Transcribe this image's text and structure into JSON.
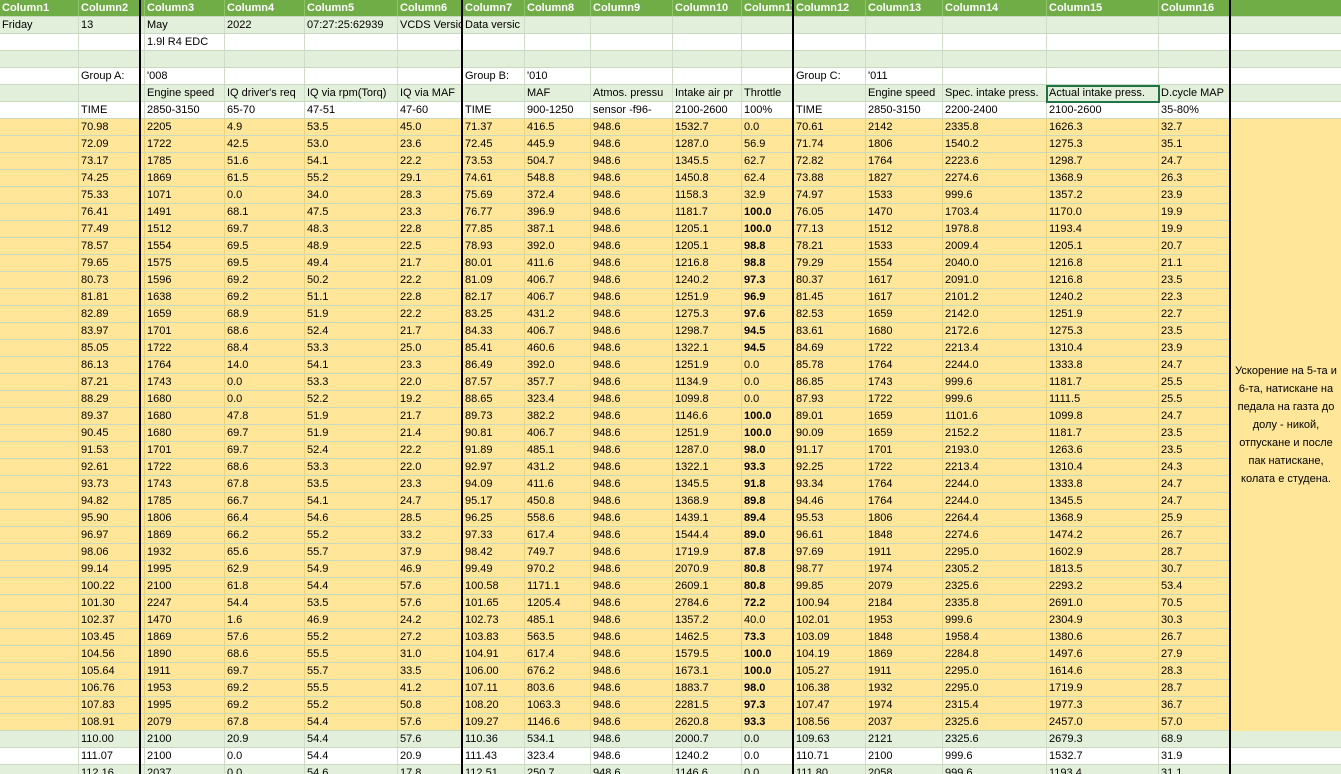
{
  "headers": [
    "Column1",
    "Column2",
    "Column3",
    "Column4",
    "Column5",
    "Column6",
    "Column7",
    "Column8",
    "Column9",
    "Column10",
    "Column11",
    "Column12",
    "Column13",
    "Column14",
    "Column15",
    "Column16"
  ],
  "top_rows": [
    {
      "style": "green",
      "cells": [
        "Friday",
        "13",
        "May",
        "2022",
        "07:27:25:62939",
        "VCDS Versio",
        "Data versic",
        "",
        "",
        "",
        "",
        "",
        "",
        "",
        "",
        ""
      ]
    },
    {
      "style": "white",
      "cells": [
        "",
        "",
        "1.9l R4 EDC",
        "",
        "",
        "",
        "",
        "",
        "",
        "",
        "",
        "",
        "",
        "",
        "",
        ""
      ]
    },
    {
      "style": "green",
      "cells": [
        "",
        "",
        "",
        "",
        "",
        "",
        "",
        "",
        "",
        "",
        "",
        "",
        "",
        "",
        "",
        ""
      ]
    },
    {
      "style": "white",
      "cells": [
        "",
        "Group A:",
        "'008",
        "",
        "",
        "",
        "Group B:",
        "'010",
        "",
        "",
        "",
        "Group C:",
        "'011",
        "",
        "",
        ""
      ]
    },
    {
      "style": "green",
      "cells": [
        "",
        "",
        "Engine speed",
        "IQ driver's req",
        "IQ via rpm(Torq)",
        "IQ via MAF",
        "",
        "MAF",
        "Atmos. pressu",
        "Intake air pr",
        "Throttle",
        "",
        "Engine speed",
        "Spec. intake press.",
        "Actual intake press.",
        "D.cycle MAP"
      ]
    },
    {
      "style": "white",
      "cells": [
        "",
        "TIME",
        "2850-3150",
        "65-70",
        "47-51",
        "47-60",
        "TIME",
        "900-1250",
        "sensor -f96-",
        "2100-2600",
        "100%",
        "TIME",
        "2850-3150",
        "2200-2400",
        "2100-2600",
        "35-80%"
      ]
    }
  ],
  "data_rows": [
    [
      "70.98",
      "2205",
      "4.9",
      "53.5",
      "45.0",
      "71.37",
      "416.5",
      "948.6",
      "1532.7",
      "0.0",
      "70.61",
      "2142",
      "2335.8",
      "1626.3",
      "32.7"
    ],
    [
      "72.09",
      "1722",
      "42.5",
      "53.0",
      "23.6",
      "72.45",
      "445.9",
      "948.6",
      "1287.0",
      "56.9",
      "71.74",
      "1806",
      "1540.2",
      "1275.3",
      "35.1"
    ],
    [
      "73.17",
      "1785",
      "51.6",
      "54.1",
      "22.2",
      "73.53",
      "504.7",
      "948.6",
      "1345.5",
      "62.7",
      "72.82",
      "1764",
      "2223.6",
      "1298.7",
      "24.7"
    ],
    [
      "74.25",
      "1869",
      "61.5",
      "55.2",
      "29.1",
      "74.61",
      "548.8",
      "948.6",
      "1450.8",
      "62.4",
      "73.88",
      "1827",
      "2274.6",
      "1368.9",
      "26.3"
    ],
    [
      "75.33",
      "1071",
      "0.0",
      "34.0",
      "28.3",
      "75.69",
      "372.4",
      "948.6",
      "1158.3",
      "32.9",
      "74.97",
      "1533",
      "999.6",
      "1357.2",
      "23.9"
    ],
    [
      "76.41",
      "1491",
      "68.1",
      "47.5",
      "23.3",
      "76.77",
      "396.9",
      "948.6",
      "1181.7",
      "100.0",
      "76.05",
      "1470",
      "1703.4",
      "1170.0",
      "19.9"
    ],
    [
      "77.49",
      "1512",
      "69.7",
      "48.3",
      "22.8",
      "77.85",
      "387.1",
      "948.6",
      "1205.1",
      "100.0",
      "77.13",
      "1512",
      "1978.8",
      "1193.4",
      "19.9"
    ],
    [
      "78.57",
      "1554",
      "69.5",
      "48.9",
      "22.5",
      "78.93",
      "392.0",
      "948.6",
      "1205.1",
      "98.8",
      "78.21",
      "1533",
      "2009.4",
      "1205.1",
      "20.7"
    ],
    [
      "79.65",
      "1575",
      "69.5",
      "49.4",
      "21.7",
      "80.01",
      "411.6",
      "948.6",
      "1216.8",
      "98.8",
      "79.29",
      "1554",
      "2040.0",
      "1216.8",
      "21.1"
    ],
    [
      "80.73",
      "1596",
      "69.2",
      "50.2",
      "22.2",
      "81.09",
      "406.7",
      "948.6",
      "1240.2",
      "97.3",
      "80.37",
      "1617",
      "2091.0",
      "1216.8",
      "23.5"
    ],
    [
      "81.81",
      "1638",
      "69.2",
      "51.1",
      "22.8",
      "82.17",
      "406.7",
      "948.6",
      "1251.9",
      "96.9",
      "81.45",
      "1617",
      "2101.2",
      "1240.2",
      "22.3"
    ],
    [
      "82.89",
      "1659",
      "68.9",
      "51.9",
      "22.2",
      "83.25",
      "431.2",
      "948.6",
      "1275.3",
      "97.6",
      "82.53",
      "1659",
      "2142.0",
      "1251.9",
      "22.7"
    ],
    [
      "83.97",
      "1701",
      "68.6",
      "52.4",
      "21.7",
      "84.33",
      "406.7",
      "948.6",
      "1298.7",
      "94.5",
      "83.61",
      "1680",
      "2172.6",
      "1275.3",
      "23.5"
    ],
    [
      "85.05",
      "1722",
      "68.4",
      "53.3",
      "25.0",
      "85.41",
      "460.6",
      "948.6",
      "1322.1",
      "94.5",
      "84.69",
      "1722",
      "2213.4",
      "1310.4",
      "23.9"
    ],
    [
      "86.13",
      "1764",
      "14.0",
      "54.1",
      "23.3",
      "86.49",
      "392.0",
      "948.6",
      "1251.9",
      "0.0",
      "85.78",
      "1764",
      "2244.0",
      "1333.8",
      "24.7"
    ],
    [
      "87.21",
      "1743",
      "0.0",
      "53.3",
      "22.0",
      "87.57",
      "357.7",
      "948.6",
      "1134.9",
      "0.0",
      "86.85",
      "1743",
      "999.6",
      "1181.7",
      "25.5"
    ],
    [
      "88.29",
      "1680",
      "0.0",
      "52.2",
      "19.2",
      "88.65",
      "323.4",
      "948.6",
      "1099.8",
      "0.0",
      "87.93",
      "1722",
      "999.6",
      "1111.5",
      "25.5"
    ],
    [
      "89.37",
      "1680",
      "47.8",
      "51.9",
      "21.7",
      "89.73",
      "382.2",
      "948.6",
      "1146.6",
      "100.0",
      "89.01",
      "1659",
      "1101.6",
      "1099.8",
      "24.7"
    ],
    [
      "90.45",
      "1680",
      "69.7",
      "51.9",
      "21.4",
      "90.81",
      "406.7",
      "948.6",
      "1251.9",
      "100.0",
      "90.09",
      "1659",
      "2152.2",
      "1181.7",
      "23.5"
    ],
    [
      "91.53",
      "1701",
      "69.7",
      "52.4",
      "22.2",
      "91.89",
      "485.1",
      "948.6",
      "1287.0",
      "98.0",
      "91.17",
      "1701",
      "2193.0",
      "1263.6",
      "23.5"
    ],
    [
      "92.61",
      "1722",
      "68.6",
      "53.3",
      "22.0",
      "92.97",
      "431.2",
      "948.6",
      "1322.1",
      "93.3",
      "92.25",
      "1722",
      "2213.4",
      "1310.4",
      "24.3"
    ],
    [
      "93.73",
      "1743",
      "67.8",
      "53.5",
      "23.3",
      "94.09",
      "411.6",
      "948.6",
      "1345.5",
      "91.8",
      "93.34",
      "1764",
      "2244.0",
      "1333.8",
      "24.7"
    ],
    [
      "94.82",
      "1785",
      "66.7",
      "54.1",
      "24.7",
      "95.17",
      "450.8",
      "948.6",
      "1368.9",
      "89.8",
      "94.46",
      "1764",
      "2244.0",
      "1345.5",
      "24.7"
    ],
    [
      "95.90",
      "1806",
      "66.4",
      "54.6",
      "28.5",
      "96.25",
      "558.6",
      "948.6",
      "1439.1",
      "89.4",
      "95.53",
      "1806",
      "2264.4",
      "1368.9",
      "25.9"
    ],
    [
      "96.97",
      "1869",
      "66.2",
      "55.2",
      "33.2",
      "97.33",
      "617.4",
      "948.6",
      "1544.4",
      "89.0",
      "96.61",
      "1848",
      "2274.6",
      "1474.2",
      "26.7"
    ],
    [
      "98.06",
      "1932",
      "65.6",
      "55.7",
      "37.9",
      "98.42",
      "749.7",
      "948.6",
      "1719.9",
      "87.8",
      "97.69",
      "1911",
      "2295.0",
      "1602.9",
      "28.7"
    ],
    [
      "99.14",
      "1995",
      "62.9",
      "54.9",
      "46.9",
      "99.49",
      "970.2",
      "948.6",
      "2070.9",
      "80.8",
      "98.77",
      "1974",
      "2305.2",
      "1813.5",
      "30.7"
    ],
    [
      "100.22",
      "2100",
      "61.8",
      "54.4",
      "57.6",
      "100.58",
      "1171.1",
      "948.6",
      "2609.1",
      "80.8",
      "99.85",
      "2079",
      "2325.6",
      "2293.2",
      "53.4"
    ],
    [
      "101.30",
      "2247",
      "54.4",
      "53.5",
      "57.6",
      "101.65",
      "1205.4",
      "948.6",
      "2784.6",
      "72.2",
      "100.94",
      "2184",
      "2335.8",
      "2691.0",
      "70.5"
    ],
    [
      "102.37",
      "1470",
      "1.6",
      "46.9",
      "24.2",
      "102.73",
      "485.1",
      "948.6",
      "1357.2",
      "40.0",
      "102.01",
      "1953",
      "999.6",
      "2304.9",
      "30.3"
    ],
    [
      "103.45",
      "1869",
      "57.6",
      "55.2",
      "27.2",
      "103.83",
      "563.5",
      "948.6",
      "1462.5",
      "73.3",
      "103.09",
      "1848",
      "1958.4",
      "1380.6",
      "26.7"
    ],
    [
      "104.56",
      "1890",
      "68.6",
      "55.5",
      "31.0",
      "104.91",
      "617.4",
      "948.6",
      "1579.5",
      "100.0",
      "104.19",
      "1869",
      "2284.8",
      "1497.6",
      "27.9"
    ],
    [
      "105.64",
      "1911",
      "69.7",
      "55.7",
      "33.5",
      "106.00",
      "676.2",
      "948.6",
      "1673.1",
      "100.0",
      "105.27",
      "1911",
      "2295.0",
      "1614.6",
      "28.3"
    ],
    [
      "106.76",
      "1953",
      "69.2",
      "55.5",
      "41.2",
      "107.11",
      "803.6",
      "948.6",
      "1883.7",
      "98.0",
      "106.38",
      "1932",
      "2295.0",
      "1719.9",
      "28.7"
    ],
    [
      "107.83",
      "1995",
      "69.2",
      "55.2",
      "50.8",
      "108.20",
      "1063.3",
      "948.6",
      "2281.5",
      "97.3",
      "107.47",
      "1974",
      "2315.4",
      "1977.3",
      "36.7"
    ],
    [
      "108.91",
      "2079",
      "67.8",
      "54.4",
      "57.6",
      "109.27",
      "1146.6",
      "948.6",
      "2620.8",
      "93.3",
      "108.56",
      "2037",
      "2325.6",
      "2457.0",
      "57.0"
    ],
    [
      "110.00",
      "2100",
      "20.9",
      "54.4",
      "57.6",
      "110.36",
      "534.1",
      "948.6",
      "2000.7",
      "0.0",
      "109.63",
      "2121",
      "2325.6",
      "2679.3",
      "68.9"
    ],
    [
      "111.07",
      "2100",
      "0.0",
      "54.4",
      "20.9",
      "111.43",
      "323.4",
      "948.6",
      "1240.2",
      "0.0",
      "110.71",
      "2100",
      "999.6",
      "1532.7",
      "31.9"
    ],
    [
      "112.16",
      "2037",
      "0.0",
      "54.6",
      "17.8",
      "112.51",
      "250.7",
      "948.6",
      "1146.6",
      "0.0",
      "111.80",
      "2058",
      "999.6",
      "1193.4",
      "31.1"
    ]
  ],
  "note": "Ускорение на 5-та и 6-та, натискане на педала на газта до долу - никой, отпускане и после пак натискане, колата е студена."
}
